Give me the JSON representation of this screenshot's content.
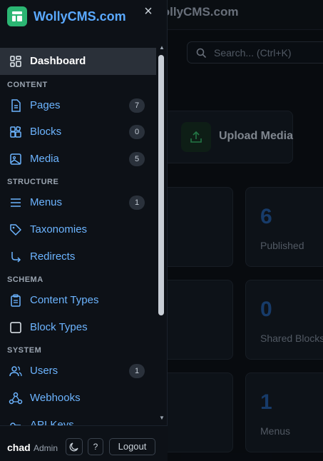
{
  "background": {
    "header_title": "WollyCMS.com",
    "search_placeholder": "Search... (Ctrl+K)",
    "upload_label": "Upload Media",
    "stats": [
      {
        "value": "6",
        "label": "Published"
      },
      {
        "value": "0",
        "label": "Shared Blocks"
      },
      {
        "value": "1",
        "label": "Menus"
      }
    ]
  },
  "drawer": {
    "brand": "WollyCMS.com",
    "close_glyph": "×",
    "sections": {
      "content": "CONTENT",
      "structure": "STRUCTURE",
      "schema": "SCHEMA",
      "system": "SYSTEM"
    },
    "items": {
      "dashboard": {
        "label": "Dashboard"
      },
      "pages": {
        "label": "Pages",
        "count": "7"
      },
      "blocks": {
        "label": "Blocks",
        "count": "0"
      },
      "media": {
        "label": "Media",
        "count": "5"
      },
      "menus": {
        "label": "Menus",
        "count": "1"
      },
      "taxonomies": {
        "label": "Taxonomies"
      },
      "redirects": {
        "label": "Redirects"
      },
      "content_types": {
        "label": "Content Types"
      },
      "block_types": {
        "label": "Block Types"
      },
      "users": {
        "label": "Users",
        "count": "1"
      },
      "webhooks": {
        "label": "Webhooks"
      },
      "api_keys": {
        "label": "API Keys"
      }
    }
  },
  "footer": {
    "user": "chad",
    "role": "Admin",
    "help": "?",
    "logout": "Logout"
  },
  "colors": {
    "accent": "#5aa9ff",
    "logo": "#2bb673",
    "bg": "#0d1117"
  }
}
